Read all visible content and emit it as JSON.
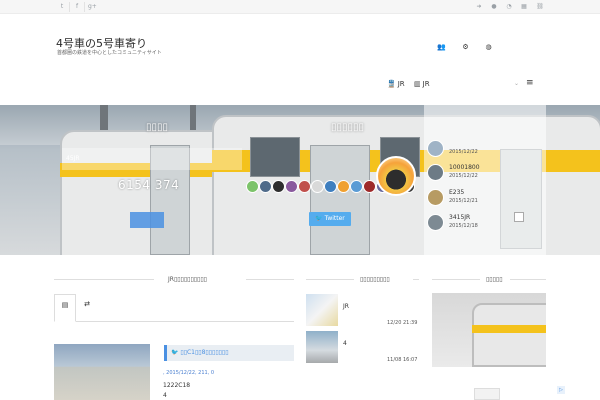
{
  "topbar": {
    "left_icons": [
      "twitter-icon",
      "facebook-icon",
      "googleplus-icon"
    ],
    "right_icons": [
      "signin-icon",
      "user-icon",
      "bell-icon",
      "apps-icon",
      "link-icon"
    ]
  },
  "header": {
    "title": "4号車の5号車寄り",
    "description": "首都圏の鉄道を中心としたコミュニティサイト",
    "icons": [
      "users-icon",
      "gear-icon",
      "globe-icon"
    ]
  },
  "nav": {
    "items": [
      {
        "icon": "train-icon",
        "label": "JR"
      },
      {
        "icon": "chart-icon",
        "label": "JR"
      }
    ]
  },
  "hero": {
    "left_label": "▯▯▯▯",
    "center_label": "▯▯▯▯▯▯",
    "panel_text": "45JR",
    "counter": "6154 374",
    "twitter_label": "Twitter",
    "side_items": [
      {
        "title": "",
        "date": "2015/12/22"
      },
      {
        "title": "10001800",
        "date": "2015/12/22"
      },
      {
        "title": "E235",
        "date": "2015/12/21"
      },
      {
        "title": "3415JR",
        "date": "2015/12/18"
      }
    ],
    "accent": "#f4c21c"
  },
  "sections": {
    "left_heading": "JR▯▯▯▯▯▯▯▯▯▯",
    "middle_heading": "▯▯▯▯▯▯▯▯▯",
    "right_heading": "▯▯▯▯▯"
  },
  "tabs": [
    {
      "icon": "calendar-icon"
    },
    {
      "icon": "shuffle-icon"
    }
  ],
  "post": {
    "title": "▯▯C1▯▯8▯▯▯▯▯▯▯",
    "meta": ", 2015/12/22, 211, 0",
    "line1": "1222C18",
    "line2": "4"
  },
  "recent": [
    {
      "title": "JR",
      "date": "12/20 21:39"
    },
    {
      "title": "4",
      "date": "11/08 16:07"
    }
  ]
}
